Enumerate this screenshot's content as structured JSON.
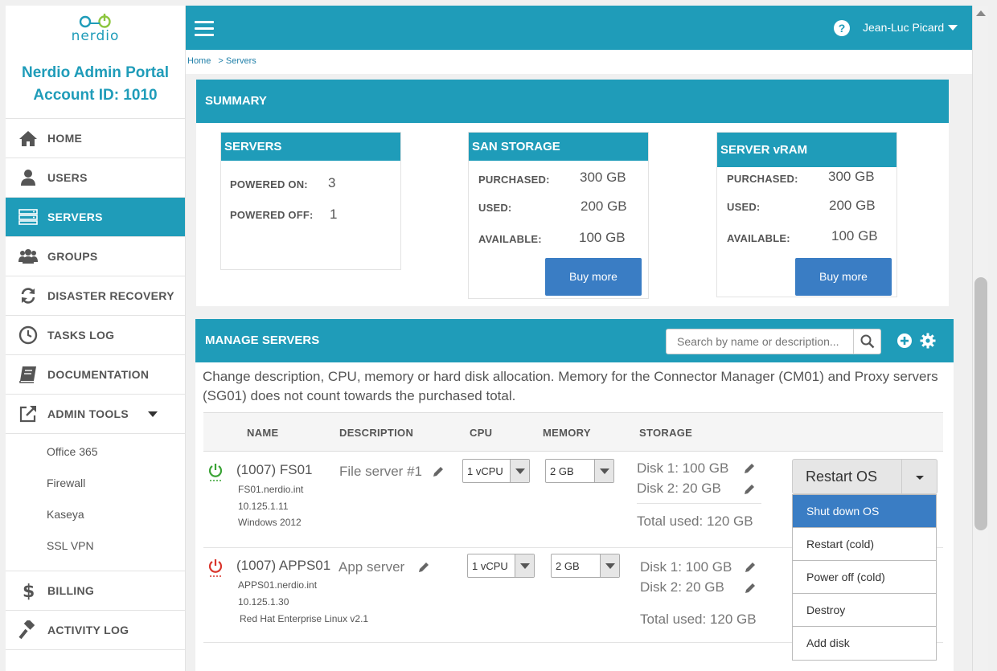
{
  "brand": {
    "logo_text": "nerdio",
    "portal_title": "Nerdio Admin Portal",
    "account_label": "Account ID: 1010"
  },
  "sidebar": {
    "items": [
      {
        "label": "HOME",
        "icon": "home-icon"
      },
      {
        "label": "USERS",
        "icon": "user-icon"
      },
      {
        "label": "SERVERS",
        "icon": "server-icon",
        "active": true
      },
      {
        "label": "GROUPS",
        "icon": "group-icon"
      },
      {
        "label": "DISASTER RECOVERY",
        "icon": "refresh-icon"
      },
      {
        "label": "TASKS LOG",
        "icon": "clock-icon"
      },
      {
        "label": "DOCUMENTATION",
        "icon": "book-icon"
      },
      {
        "label": "ADMIN TOOLS",
        "icon": "external-link-icon"
      }
    ],
    "admin_tools": [
      "Office 365",
      "Firewall",
      "Kaseya",
      "SSL VPN"
    ],
    "items_bottom": [
      {
        "label": "BILLING",
        "icon": "dollar-icon"
      },
      {
        "label": "ACTIVITY LOG",
        "icon": "gavel-icon"
      }
    ]
  },
  "topbar": {
    "user_name": "Jean-Luc Picard",
    "help_label": "?"
  },
  "breadcrumb": {
    "home": "Home",
    "current": "> Servers"
  },
  "summary": {
    "title": "SUMMARY",
    "servers": {
      "title": "SERVERS",
      "on_label": "POWERED ON:",
      "on_value": "3",
      "off_label": "POWERED OFF:",
      "off_value": "1"
    },
    "san": {
      "title": "SAN STORAGE",
      "purchased_label": "PURCHASED:",
      "purchased": "300 GB",
      "used_label": "USED:",
      "used": "200 GB",
      "available_label": "AVAILABLE:",
      "available": "100 GB",
      "button": "Buy more"
    },
    "vram": {
      "title": "SERVER vRAM",
      "purchased_label": "PURCHASED:",
      "purchased": "300 GB",
      "used_label": "USED:",
      "used": "200 GB",
      "available_label": "AVAILABLE:",
      "available": "100 GB",
      "button": "Buy more"
    }
  },
  "manage": {
    "title": "MANAGE SERVERS",
    "search_placeholder": "Search by name or description...",
    "description": "Change description, CPU, memory or hard disk allocation. Memory for the Connector Manager (CM01) and Proxy servers (SG01) does not count towards the purchased total.",
    "columns": {
      "name": "NAME",
      "description": "DESCRIPTION",
      "cpu": "CPU",
      "memory": "MEMORY",
      "storage": "STORAGE"
    },
    "servers": [
      {
        "name": "(1007) FS01",
        "fqdn": "FS01.nerdio.int",
        "ip": "10.125.1.11",
        "os": "Windows 2012",
        "description": "File server #1",
        "cpu": "1 vCPU",
        "memory": "2 GB",
        "disk1": "Disk 1: 100 GB",
        "disk2": "Disk 2: 20 GB",
        "total": "Total used: 120 GB",
        "status": "on",
        "status_color": "#3aa335"
      },
      {
        "name": "(1007) APPS01",
        "fqdn": "APPS01.nerdio.int",
        "ip": "10.125.1.30",
        "os": "Red Hat Enterprise Linux v2.1",
        "description": "App server",
        "cpu": "1 vCPU",
        "memory": "2 GB",
        "disk1": "Disk 1: 100 GB",
        "disk2": "Disk 2: 20 GB",
        "total": "Total used: 120 GB",
        "status": "off",
        "status_color": "#d9342b"
      }
    ],
    "action_button": "Restart OS",
    "menu": [
      "Shut down OS",
      "Restart (cold)",
      "Power off (cold)",
      "Destroy",
      "Add disk"
    ]
  },
  "colors": {
    "accent": "#1f9cb9",
    "button_blue": "#3a7dc4"
  }
}
